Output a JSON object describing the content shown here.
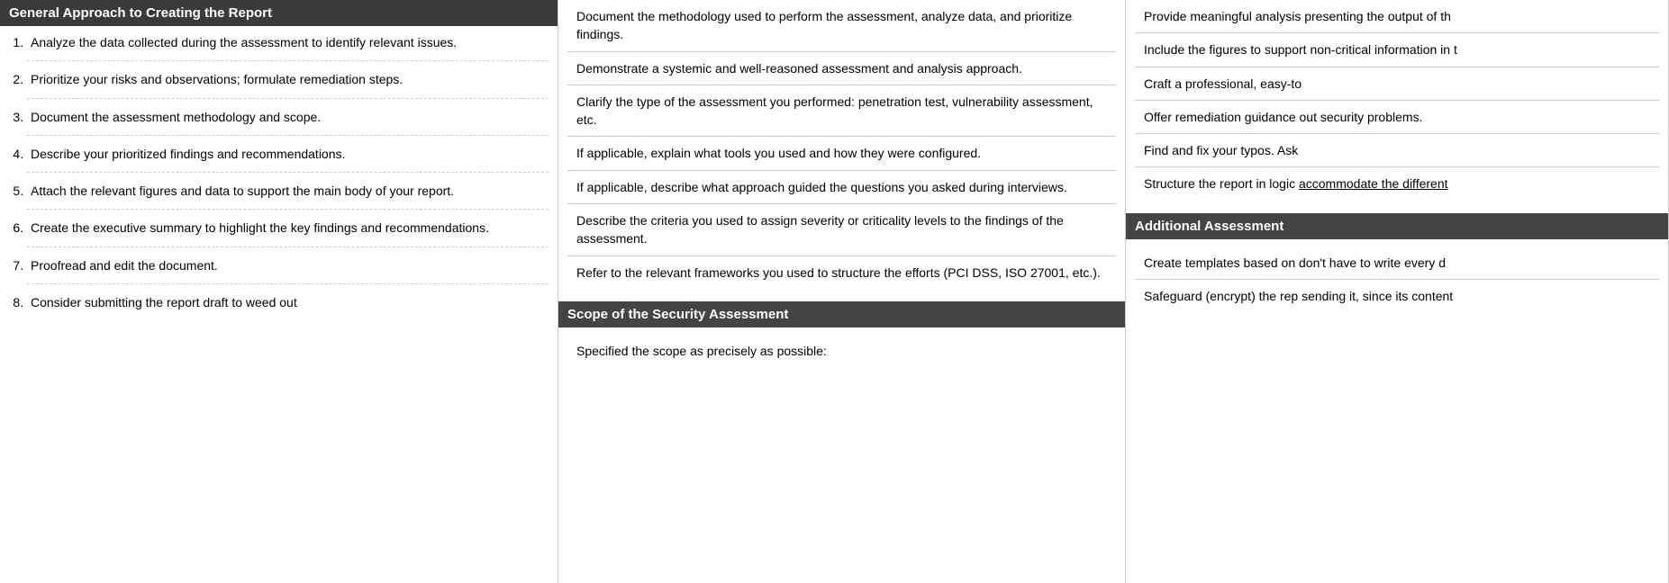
{
  "column1": {
    "header": "General Approach to Creating the Report",
    "items": [
      "Analyze the data collected during the assessment to identify relevant issues.",
      "Prioritize your risks and observations; formulate remediation steps.",
      "Document the assessment methodology and scope.",
      "Describe your prioritized findings and recommendations.",
      "Attach the relevant figures and data to support the main body of your report.",
      "Create the executive summary to highlight the key findings and recommendations.",
      "Proofread and edit the document.",
      "Consider submitting the report draft to weed out"
    ]
  },
  "column2": {
    "blocks": [
      "Document the methodology used to perform the assessment, analyze data, and prioritize findings.",
      "Demonstrate a systemic and well-reasoned assessment and analysis approach.",
      "Clarify the type of the assessment you performed: penetration test, vulnerability assessment, etc.",
      "If applicable, explain what tools you used and how they were configured.",
      "If applicable, describe what approach guided the questions you asked during interviews.",
      "Describe the criteria you used to assign severity or criticality levels to the findings of the assessment.",
      "Refer to the relevant frameworks you used to structure the efforts (PCI DSS, ISO 27001, etc.)."
    ],
    "section2_header": "Scope of the Security Assessment",
    "section2_text": "Specified the scope as precisely as possible:"
  },
  "column3": {
    "blocks": [
      "Provide meaningful analysis presenting the output of th",
      "Include the figures to support non-critical information in t",
      "Craft a professional, easy-to",
      "Offer remediation guidance out security problems.",
      "Find and fix your typos. Ask",
      "Structure the report in logic accommodate the different"
    ],
    "section2_header": "Additional Assessment",
    "section2_blocks": [
      "Create templates based on don't have to write every d",
      "Safeguard (encrypt) the rep sending it, since its content"
    ]
  }
}
